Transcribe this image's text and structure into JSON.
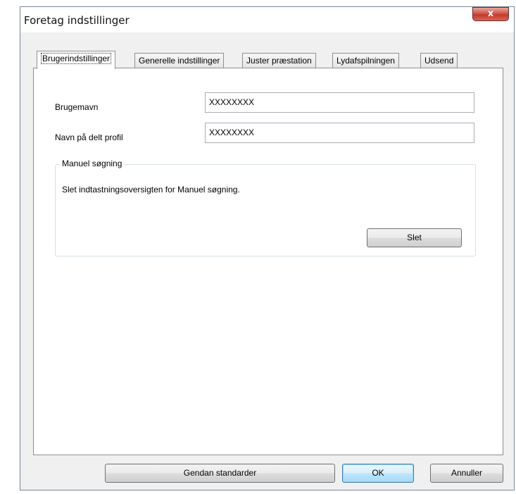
{
  "window": {
    "title": "Foretag indstillinger",
    "close_label": "x"
  },
  "tabs": [
    {
      "label": "Brugerindstillinger",
      "active": true
    },
    {
      "label": "Generelle indstillinger",
      "active": false
    },
    {
      "label": "Juster præstation",
      "active": false
    },
    {
      "label": "Lydafspilningen",
      "active": false
    },
    {
      "label": "Udsend",
      "active": false
    }
  ],
  "user_settings": {
    "username_label": "Brugemavn",
    "username_value": "XXXXXXXX",
    "shared_profile_label": "Navn på delt profil",
    "shared_profile_value": "XXXXXXXX"
  },
  "manual_search": {
    "title": "Manuel søgning",
    "description": "Slet indtastningsoversigten for Manuel søgning.",
    "delete_label": "Slet"
  },
  "footer": {
    "restore_label": "Gendan standarder",
    "ok_label": "OK",
    "cancel_label": "Annuller"
  }
}
